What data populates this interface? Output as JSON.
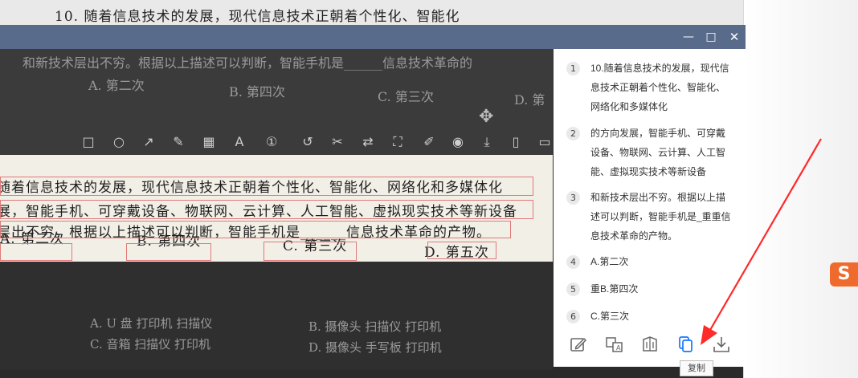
{
  "background": {
    "top_line": "10. 随着信息技术的发展，现代信息技术正朝着个性化、智能化",
    "dark_lines": [
      "和新技术层出不穷。根据以上描述可以判断，智能手机是______信息技术革命的",
      "A. 第二次",
      "B. 第四次",
      "C. 第三次",
      "D. 第",
      "A. U 盘  打印机  扫描仪",
      "B. 摄像头  扫描仪  打印机",
      "C. 音箱  扫描仪  打印机",
      "D. 摄像头  手写板  打印机"
    ],
    "crop_lines": [
      "随着信息技术的发展，现代信息技术正朝着个性化、智能化、网络化和多媒体化",
      "展，智能手机、可穿戴设备、物联网、云计算、人工智能、虚拟现实技术等新设备",
      "层出不穷。根据以上描述可以判断，智能手机是______信息技术革命的产物。",
      "A. 第二次",
      "B. 第四次",
      "C. 第三次",
      "D. 第五次"
    ],
    "sogou_glyph": "S"
  },
  "window": {
    "minimize_glyph": "—",
    "maximize_glyph": "□",
    "close_glyph": "✕"
  },
  "toolbar_icons": [
    "rectangle-icon",
    "circle-icon",
    "arrow-icon",
    "pen-icon",
    "mosaic-icon",
    "text-icon",
    "number-icon",
    "undo-icon",
    "ocr-icon",
    "translate-icon",
    "fullscreen-icon",
    "pin-icon",
    "record-icon",
    "download-icon",
    "bookmark-icon",
    "more-icon"
  ],
  "ocr_results": [
    {
      "num": "1",
      "text": "10.随着信息技术的发展，现代信息技术正朝着个性化、智能化、网络化和多媒体化"
    },
    {
      "num": "2",
      "text": "的方向发展，智能手机、可穿戴设备、物联网、云计算、人工智能、虚拟现实技术等新设备"
    },
    {
      "num": "3",
      "text": "和新技术层出不穷。根据以上描述可以判断，智能手机是_重重信息技术革命的产物。"
    },
    {
      "num": "4",
      "text": "A.第二次"
    },
    {
      "num": "5",
      "text": "重B.第四次"
    },
    {
      "num": "6",
      "text": "C.第三次"
    }
  ],
  "footer": {
    "buttons": [
      "edit-icon",
      "translate-icon",
      "page-icon",
      "copy-icon",
      "download-icon"
    ],
    "tooltip": "复制",
    "accent": "#1677ff"
  },
  "annotation": {
    "arrow_color": "#ff2a2a"
  }
}
